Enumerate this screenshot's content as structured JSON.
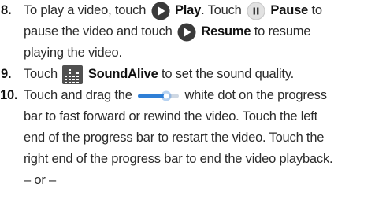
{
  "steps": [
    {
      "number": "8.",
      "parts": {
        "a": "To play a video, touch",
        "play_icon": "play-icon",
        "play": "Play",
        "b": ". Touch",
        "pause_icon": "pause-icon",
        "pause": "Pause",
        "c": "to",
        "line2": "pause the video and touch",
        "resume_icon": "resume-icon",
        "resume": "Resume",
        "d": "to resume",
        "line3": "playing the video."
      }
    },
    {
      "number": "9.",
      "parts": {
        "a": "Touch",
        "soundalive_icon": "equalizer-icon",
        "soundalive": "SoundAlive",
        "b": "to set the sound quality."
      }
    },
    {
      "number": "10.",
      "parts": {
        "a": "Touch and drag the",
        "slider_icon": "progress-slider-icon",
        "b": "white dot on the progress",
        "line2": "bar to fast forward or rewind the video. Touch the left",
        "line3": "end of the progress bar to restart the video. Touch the",
        "line4": "right end of the progress bar to end the video playback.",
        "line5": "– or –"
      }
    }
  ],
  "colors": {
    "text": "#2b2b2b",
    "icon_dark": "#3a3a3a",
    "icon_light_bg": "#dcdcdc",
    "slider_blue": "#2f7fd6"
  }
}
